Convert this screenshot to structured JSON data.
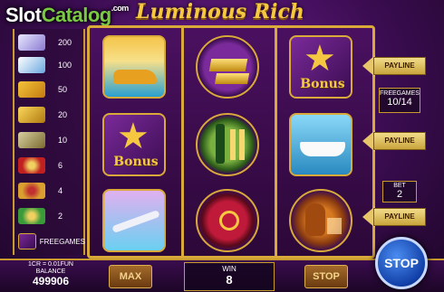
{
  "header": {
    "brand_slot": "Slot",
    "brand_catalog": "Catalog",
    "brand_com": ".com",
    "game_title": "Luminous Rich"
  },
  "paytable": {
    "rows": [
      {
        "value": "200",
        "icon": "gem-stack-icon"
      },
      {
        "value": "100",
        "icon": "yacht-icon"
      },
      {
        "value": "50",
        "icon": "car-icon"
      },
      {
        "value": "20",
        "icon": "gold-bars-icon"
      },
      {
        "value": "10",
        "icon": "money-stack-icon"
      },
      {
        "value": "6",
        "icon": "red-chip-icon"
      },
      {
        "value": "4",
        "icon": "gold-ring-icon"
      },
      {
        "value": "2",
        "icon": "green-chip-icon"
      }
    ],
    "bonus_label": "FREEGAMES"
  },
  "reels": {
    "symbols": [
      [
        "sports-car-icon",
        "bonus-star-icon",
        "private-jet-icon"
      ],
      [
        "gold-bars-icon",
        "champagne-icon",
        "red-scarf-icon"
      ],
      [
        "bonus-star-icon",
        "yacht-icon",
        "cognac-icon"
      ]
    ],
    "bonus_text": "Bonus"
  },
  "side": {
    "payline_label": "PAYLINE",
    "freegames_label": "FREEGAMES",
    "freegames_value": "10/14",
    "bet_label": "BET",
    "bet_value": "2"
  },
  "footer": {
    "denomination": "1CR = 0.01FUN",
    "balance_label": "BALANCE",
    "balance_value": "499906",
    "max_label": "MAX",
    "win_label": "WIN",
    "win_value": "8",
    "stop_label": "STOP",
    "spin_stop_label": "STOP"
  },
  "colors": {
    "gold": "#d9a93a",
    "purple_dark": "#2a0a3a",
    "purple_light": "#6a1d8a",
    "brand_green": "#7ac943",
    "spin_blue": "#1240a8"
  }
}
